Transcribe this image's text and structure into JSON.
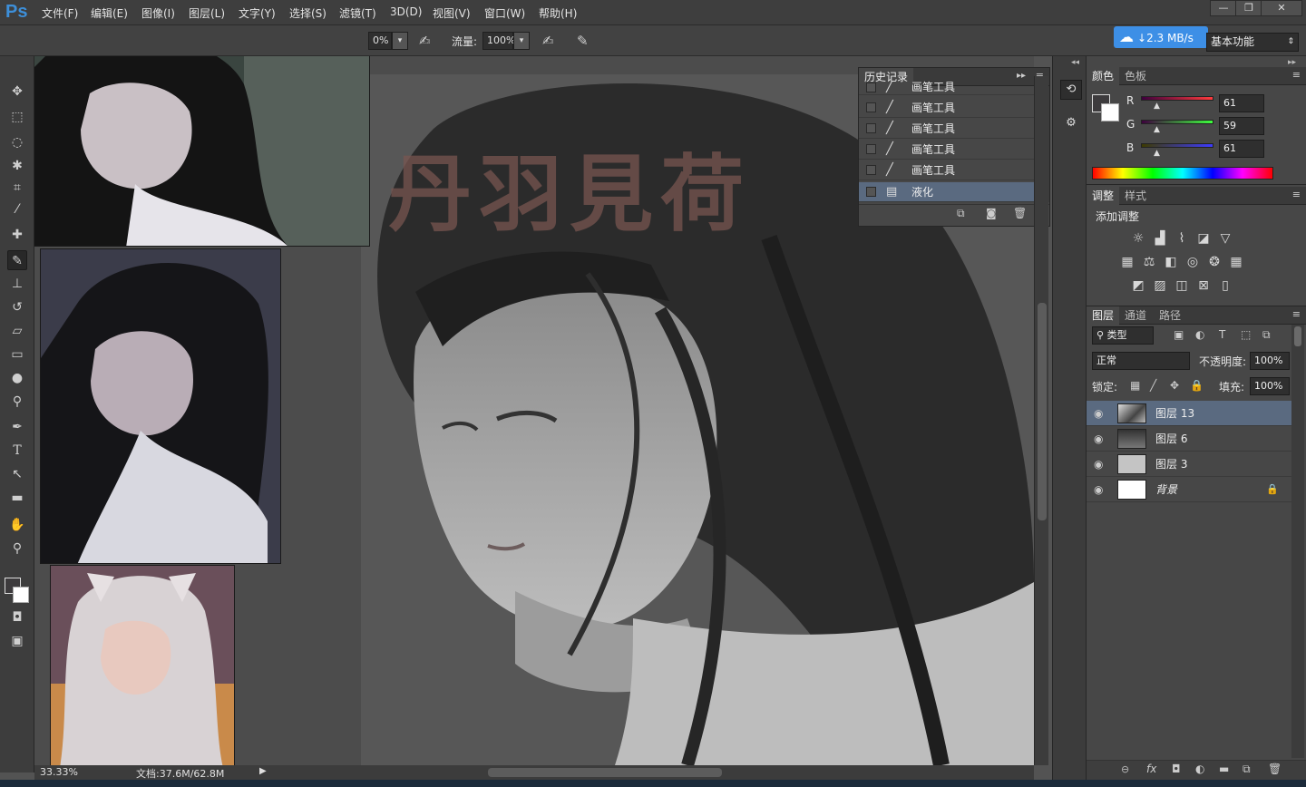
{
  "app": {
    "logo": "Ps"
  },
  "menu": [
    "文件(F)",
    "编辑(E)",
    "图像(I)",
    "图层(L)",
    "文字(Y)",
    "选择(S)",
    "滤镜(T)",
    "3D(D)",
    "视图(V)",
    "窗口(W)",
    "帮助(H)"
  ],
  "window_controls": [
    "—",
    "❐",
    "✕"
  ],
  "options": {
    "opacity_value": "0%",
    "flow_label": "流量:",
    "flow_value": "100%",
    "workspace": "基本功能"
  },
  "network": {
    "speed": "2.3 MB/s"
  },
  "history": {
    "tab": "历史记录",
    "items": [
      {
        "label": "画笔工具",
        "icon": "brush-icon"
      },
      {
        "label": "画笔工具",
        "icon": "brush-icon"
      },
      {
        "label": "画笔工具",
        "icon": "brush-icon"
      },
      {
        "label": "画笔工具",
        "icon": "brush-icon"
      },
      {
        "label": "画笔工具",
        "icon": "brush-icon"
      },
      {
        "label": "液化",
        "icon": "document-icon"
      }
    ]
  },
  "color_panel": {
    "tabs": [
      "颜色",
      "色板"
    ],
    "channels": [
      {
        "name": "R",
        "value": "61"
      },
      {
        "name": "G",
        "value": "59"
      },
      {
        "name": "B",
        "value": "61"
      }
    ],
    "foreground": "#3d3b3d"
  },
  "adjustments": {
    "tabs": [
      "调整",
      "样式"
    ],
    "title": "添加调整"
  },
  "layers_panel": {
    "tabs": [
      "图层",
      "通道",
      "路径"
    ],
    "filter_kind": "类型",
    "blend_mode": "正常",
    "opacity_label": "不透明度:",
    "opacity_value": "100%",
    "lock_label": "锁定:",
    "fill_label": "填充:",
    "fill_value": "100%",
    "layers": [
      {
        "name": "图层 13",
        "selected": true
      },
      {
        "name": "图层 6",
        "selected": false
      },
      {
        "name": "图层 3",
        "selected": false
      },
      {
        "name": "背景",
        "selected": false,
        "locked": true
      }
    ]
  },
  "canvas": {
    "watermark": "丹羽見荷"
  },
  "status": {
    "zoom": "33.33%",
    "doc_info": "文档:37.6M/62.8M"
  }
}
